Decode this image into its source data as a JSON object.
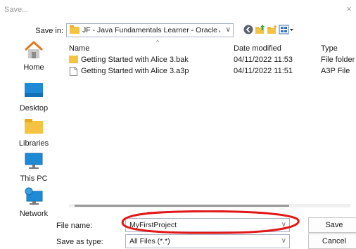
{
  "window": {
    "title": "Save...",
    "close_glyph": "×"
  },
  "toolbar": {
    "save_in_label": "Save in:",
    "location": "JF - Java Fundamentals Learner - Oracle Academ",
    "icons": [
      "back-icon",
      "up-folder-icon",
      "new-folder-icon",
      "view-menu-icon"
    ]
  },
  "sidebar": {
    "items": [
      {
        "label": "Home",
        "icon": "home-icon"
      },
      {
        "label": "Desktop",
        "icon": "desktop-icon"
      },
      {
        "label": "Libraries",
        "icon": "libraries-icon"
      },
      {
        "label": "This PC",
        "icon": "computer-icon"
      },
      {
        "label": "Network",
        "icon": "network-icon"
      }
    ]
  },
  "file_list": {
    "columns": [
      "Name",
      "Date modified",
      "Type"
    ],
    "rows": [
      {
        "name": "Getting Started with Alice 3.bak",
        "date": "04/11/2022 11:53",
        "type": "File folder",
        "icon": "folder-icon"
      },
      {
        "name": "Getting Started with Alice 3.a3p",
        "date": "04/11/2022 11:51",
        "type": "A3P File",
        "icon": "file-icon"
      }
    ]
  },
  "form": {
    "file_name_label": "File name:",
    "file_name_value": "MyFirstProject",
    "save_as_label": "Save as type:",
    "save_as_value": "All Files (*.*)"
  },
  "buttons": {
    "save": "Save",
    "cancel": "Cancel"
  },
  "colors": {
    "folder": "#f5c342",
    "annotation": "#e01818",
    "border": "#aab4c6"
  }
}
